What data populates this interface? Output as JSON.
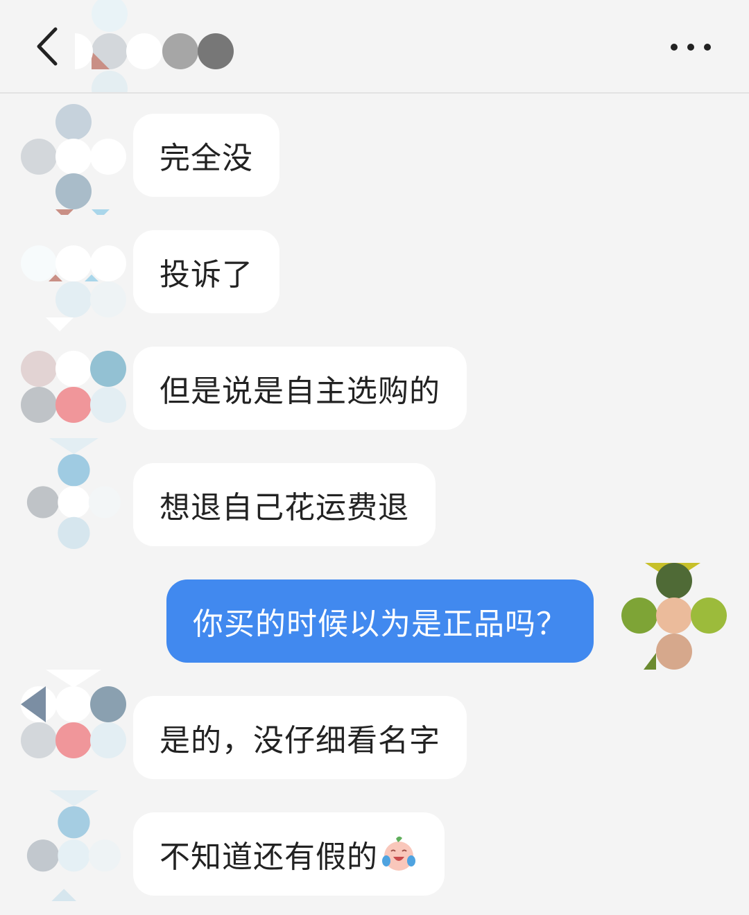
{
  "header": {
    "back_icon": "chevron-left-icon",
    "more_icon": "more-horizontal-icon",
    "contact_name_obscured": true
  },
  "messages": [
    {
      "side": "incoming",
      "text": "完全没"
    },
    {
      "side": "incoming",
      "text": "投诉了"
    },
    {
      "side": "incoming",
      "text": "但是说是自主选购的"
    },
    {
      "side": "incoming",
      "text": "想退自己花运费退"
    },
    {
      "side": "outgoing",
      "text": "你买的时候以为是正品吗？"
    },
    {
      "side": "incoming",
      "text": "是的，没仔细看名字"
    },
    {
      "side": "incoming",
      "text": "不知道还有假的",
      "emoji": "crying-laughing-emoji"
    }
  ],
  "colors": {
    "background": "#f4f4f4",
    "incoming_bubble": "#ffffff",
    "outgoing_bubble": "#4189ef",
    "incoming_text": "#222222",
    "outgoing_text": "#ffffff"
  }
}
